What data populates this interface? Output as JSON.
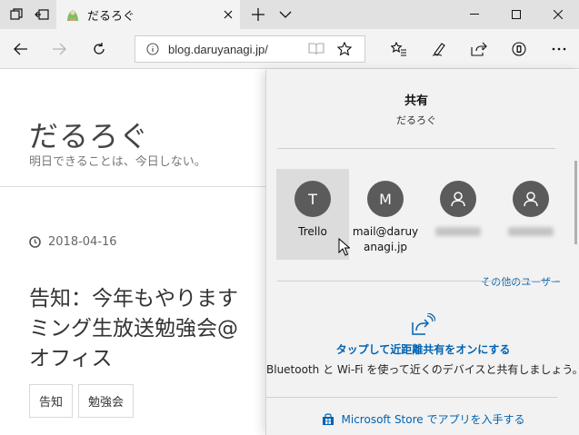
{
  "browser": {
    "tab_title": "だるろぐ",
    "address_url": "blog.daruyanagi.jp/"
  },
  "page": {
    "site_title": "だるろぐ",
    "tagline": "明日できることは、今日しない。",
    "post_date": "2018-04-16",
    "post_title_lines": [
      "告知：今年もやります",
      "ミング生放送勉強会@",
      "オフィス"
    ],
    "tags": [
      "告知",
      "勉強会"
    ]
  },
  "share": {
    "title": "共有",
    "subtitle": "だるろぐ",
    "targets": [
      {
        "initial": "T",
        "label": "Trello"
      },
      {
        "initial": "M",
        "label_line1": "mail@daruy",
        "label_line2": "anagi.jp"
      },
      {
        "initial": ""
      },
      {
        "initial": ""
      }
    ],
    "other_users_link": "その他のユーザー",
    "nearby_link": "タップして近距離共有をオンにする",
    "nearby_description": "Bluetooth と Wi-Fi を使って近くのデバイスと共有しましょう。",
    "store_link": "Microsoft Store でアプリを入手する"
  },
  "colors": {
    "accent_blue": "#0063b1",
    "avatar_gray": "#5b5b5b",
    "tab_strip": "#e1e1e1",
    "pane_background": "#f2f2f2"
  },
  "icons": [
    "tab-actions-icon",
    "set-tabs-aside-icon",
    "site-favicon",
    "close-icon",
    "new-tab-icon",
    "chevron-down-icon",
    "minimize-icon",
    "maximize-icon",
    "window-close-icon",
    "back-icon",
    "forward-icon",
    "refresh-icon",
    "info-icon",
    "reading-view-icon",
    "favorite-star-icon",
    "favorites-hub-icon",
    "pen-icon",
    "share-icon",
    "extension-icon",
    "more-icon",
    "person-icon",
    "nearby-share-icon",
    "store-icon",
    "clock-icon"
  ]
}
